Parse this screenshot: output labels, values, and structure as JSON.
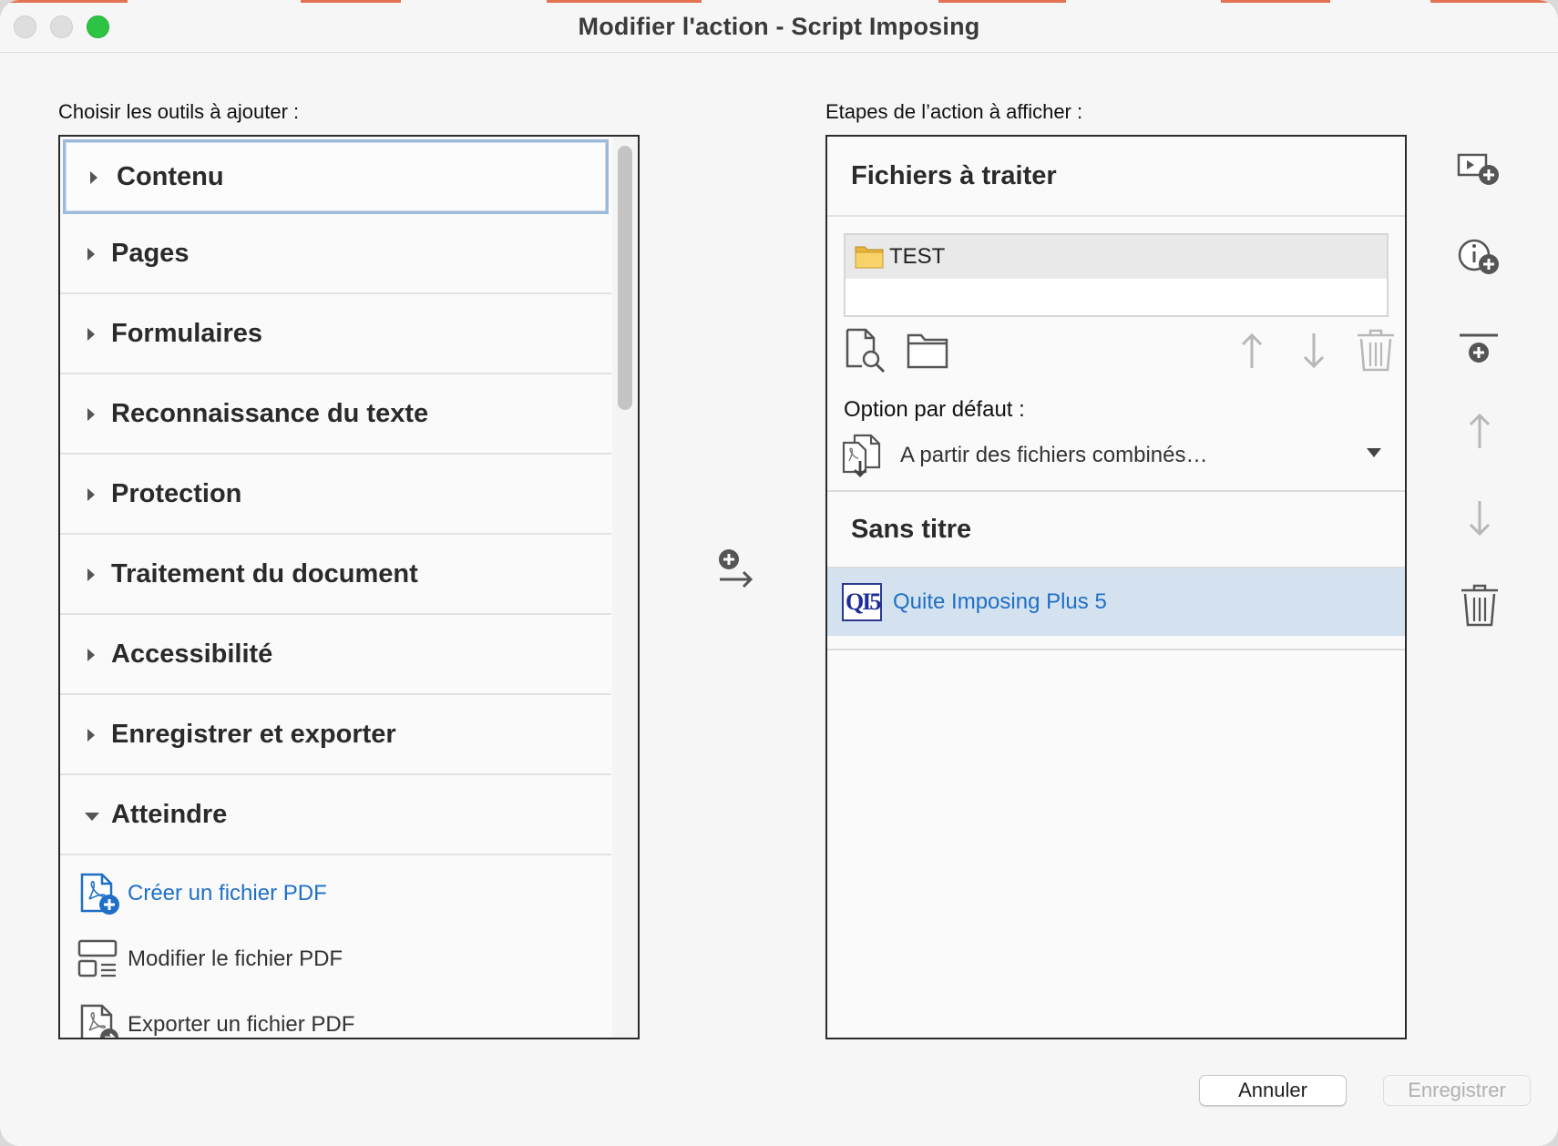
{
  "window": {
    "title": "Modifier l'action - Script Imposing",
    "accent_color": "#e4714f"
  },
  "left": {
    "label": "Choisir les outils à ajouter :",
    "categories": [
      {
        "label": "Contenu",
        "expanded": false
      },
      {
        "label": "Pages",
        "expanded": false
      },
      {
        "label": "Formulaires",
        "expanded": false
      },
      {
        "label": "Reconnaissance du texte",
        "expanded": false
      },
      {
        "label": "Protection",
        "expanded": false
      },
      {
        "label": "Traitement du document",
        "expanded": false
      },
      {
        "label": "Accessibilité",
        "expanded": false
      },
      {
        "label": "Enregistrer et exporter",
        "expanded": false
      },
      {
        "label": "Atteindre",
        "expanded": true
      }
    ],
    "tools": [
      {
        "label": "Créer un fichier PDF",
        "icon": "create-pdf-icon"
      },
      {
        "label": "Modifier le fichier PDF",
        "icon": "edit-pdf-icon"
      },
      {
        "label": "Exporter un fichier PDF",
        "icon": "export-pdf-icon"
      }
    ]
  },
  "right": {
    "label": "Etapes de l’action à afficher :",
    "files_header": "Fichiers à traiter",
    "files": [
      {
        "name": "TEST",
        "icon": "folder-icon"
      }
    ],
    "option_label": "Option par défaut :",
    "option_value": "A partir des fichiers combinés…",
    "step_header": "Sans titre",
    "steps": [
      {
        "label": "Quite Imposing Plus 5",
        "logo": "QI5"
      }
    ],
    "selection_color": "#d4e2ef",
    "link_color": "#1f6fc6"
  },
  "buttons": {
    "cancel": "Annuler",
    "save": "Enregistrer"
  }
}
